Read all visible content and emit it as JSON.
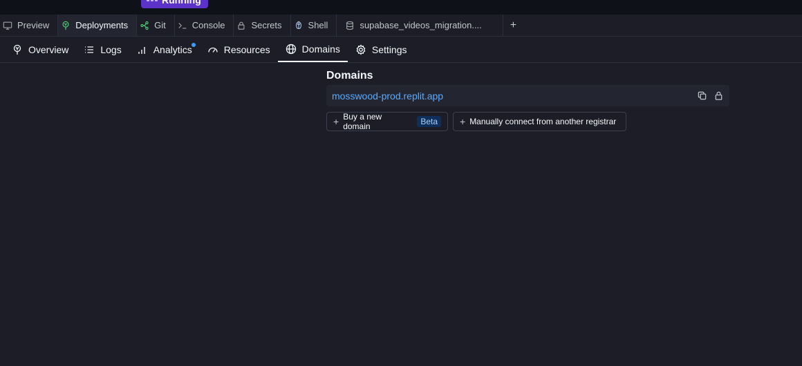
{
  "status": {
    "label": "Running"
  },
  "tabs": [
    {
      "label": "Preview",
      "icon": "monitor-icon"
    },
    {
      "label": "Deployments",
      "icon": "deployments-icon",
      "active": true
    },
    {
      "label": "Git",
      "icon": "git-icon"
    },
    {
      "label": "Console",
      "icon": "terminal-icon"
    },
    {
      "label": "Secrets",
      "icon": "lock-icon"
    },
    {
      "label": "Shell",
      "icon": "shell-icon"
    },
    {
      "label": "supabase_videos_migration....",
      "icon": "database-icon"
    }
  ],
  "add_tab": "+",
  "subnav": [
    {
      "label": "Overview",
      "icon": "deployments-icon"
    },
    {
      "label": "Logs",
      "icon": "list-icon"
    },
    {
      "label": "Analytics",
      "icon": "bar-chart-icon"
    },
    {
      "label": "Resources",
      "icon": "gauge-icon"
    },
    {
      "label": "Domains",
      "icon": "globe-icon",
      "active": true
    },
    {
      "label": "Settings",
      "icon": "gear-icon"
    }
  ],
  "domains": {
    "title": "Domains",
    "url": "mosswood-prod.replit.app",
    "buy_label": "Buy a new domain",
    "beta_label": "Beta",
    "connect_label": "Manually connect from another registrar",
    "plus": "+"
  },
  "colors": {
    "background": "#1c1d26",
    "accent": "#57abff",
    "running": "#5b33c9",
    "deployments_icon": "#4fd37a",
    "git_icon": "#4fd37a"
  }
}
